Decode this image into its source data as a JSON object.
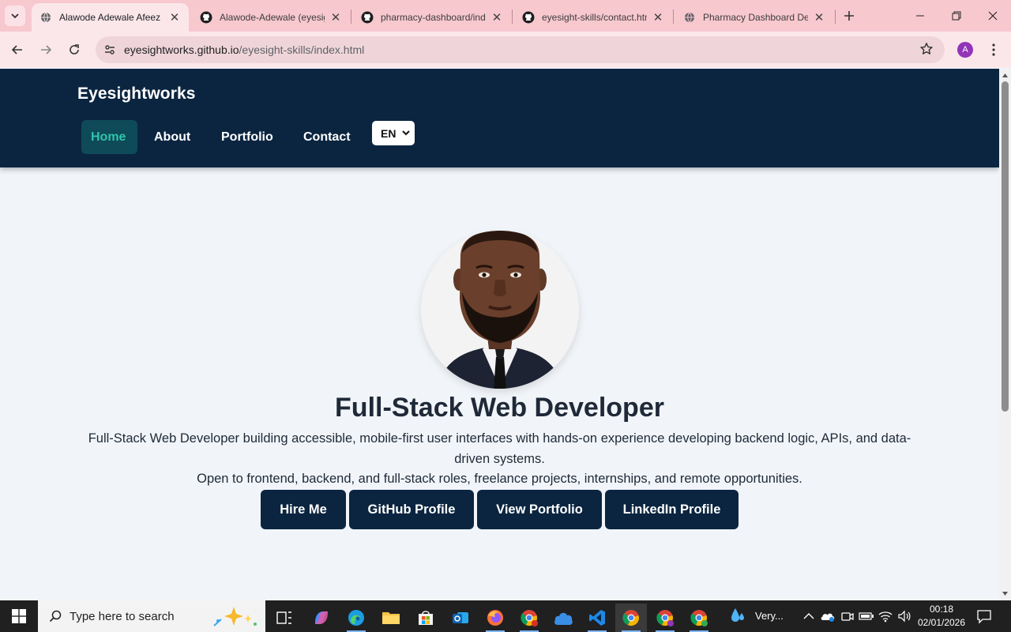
{
  "browser": {
    "tabs": [
      {
        "title": "Alawode Adewale Afeez |",
        "icon": "globe-icon",
        "active": true
      },
      {
        "title": "Alawode-Adewale (eyesight",
        "icon": "github-icon",
        "active": false
      },
      {
        "title": "pharmacy-dashboard/index",
        "icon": "github-icon",
        "active": false
      },
      {
        "title": "eyesight-skills/contact.htm",
        "icon": "github-icon",
        "active": false
      },
      {
        "title": "Pharmacy Dashboard De",
        "icon": "globe-icon",
        "active": false
      }
    ],
    "url_host": "eyesightworks.github.io",
    "url_path": "/eyesight-skills/index.html",
    "profile_initial": "A"
  },
  "site": {
    "logo": "Eyesightworks",
    "nav": [
      "Home",
      "About",
      "Portfolio",
      "Contact"
    ],
    "active_nav": "Home",
    "language": "EN"
  },
  "hero": {
    "title": "Full-Stack Web Developer",
    "description": "Full-Stack Web Developer building accessible, mobile-first user interfaces with hands-on experience developing backend logic, APIs, and data-driven systems.",
    "subtitle": "Open to frontend, backend, and full-stack roles, freelance projects, internships, and remote opportunities.",
    "buttons": [
      "Hire Me",
      "GitHub Profile",
      "View Portfolio",
      "LinkedIn Profile"
    ]
  },
  "taskbar": {
    "search_placeholder": "Type here to search",
    "weather": "Very...",
    "time": "00:18",
    "date": "02/01/2026"
  },
  "colors": {
    "header_bg": "#0b2540",
    "accent": "#2fc4ae",
    "button_bg": "#0b2540",
    "tabstrip": "#f8c8cf"
  }
}
